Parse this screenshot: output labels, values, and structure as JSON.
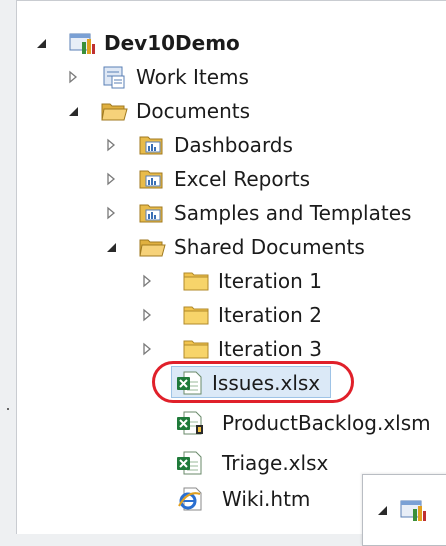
{
  "tree": {
    "root": {
      "label": "Dev10Demo",
      "icon": "team-project-icon"
    },
    "work_items": {
      "label": "Work Items",
      "icon": "work-items-icon"
    },
    "documents": {
      "label": "Documents",
      "icon": "folder-open-icon"
    },
    "dashboards": {
      "label": "Dashboards",
      "icon": "sharepoint-folder-icon"
    },
    "excel_reports": {
      "label": "Excel Reports",
      "icon": "sharepoint-folder-icon"
    },
    "samples": {
      "label": "Samples and Templates",
      "icon": "sharepoint-folder-icon"
    },
    "shared_documents": {
      "label": "Shared Documents",
      "icon": "folder-open-icon"
    },
    "iteration1": {
      "label": "Iteration 1",
      "icon": "folder-icon"
    },
    "iteration2": {
      "label": "Iteration 2",
      "icon": "folder-icon"
    },
    "iteration3": {
      "label": "Iteration 3",
      "icon": "folder-icon"
    },
    "issues": {
      "label": "Issues.xlsx",
      "icon": "excel-file-icon"
    },
    "product_backlog": {
      "label": "ProductBacklog.xlsm",
      "icon": "excel-macro-file-icon"
    },
    "triage": {
      "label": "Triage.xlsx",
      "icon": "excel-file-icon"
    },
    "wiki": {
      "label": "Wiki.htm",
      "icon": "ie-html-file-icon"
    }
  },
  "colors": {
    "highlight": "#e0202a",
    "selection": "#dbe9f7",
    "folder": "#f2c44e",
    "excel": "#1f7a3a"
  }
}
